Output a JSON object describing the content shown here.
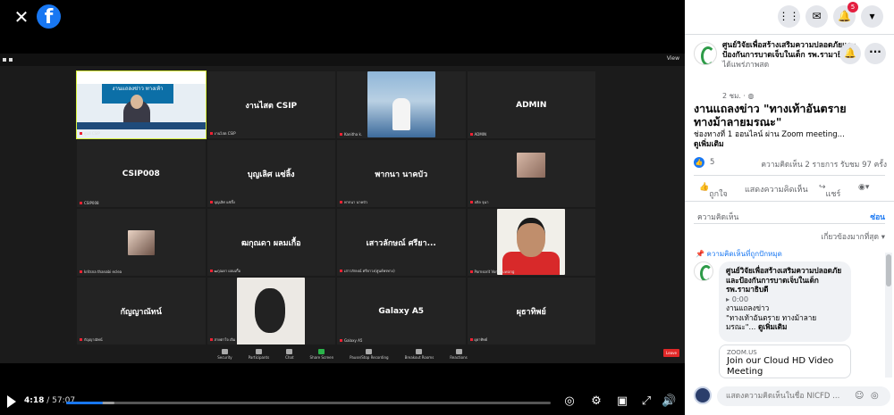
{
  "video": {
    "close_icon": "close-icon",
    "logo_letter": "f",
    "zoom": {
      "view_label": "View",
      "tiles": [
        {
          "name": "",
          "label": "ศูนย์ CSIP",
          "kind": "speaker",
          "slide_text": "งานแถลงข่าว ทางเท้า"
        },
        {
          "name": "งานไสต CSIP",
          "label": "งานไสต CSIP",
          "kind": "name"
        },
        {
          "name": "",
          "label": "Kanitha k.",
          "kind": "photo-lady"
        },
        {
          "name": "ADMIN",
          "label": "ADMIN",
          "kind": "name"
        },
        {
          "name": "CSIP008",
          "label": "CSIP008",
          "kind": "name"
        },
        {
          "name": "บุญเลิศ แซ่ลิ้ง",
          "label": "บุญเลิศ แซ่ลิ้ง",
          "kind": "name"
        },
        {
          "name": "พากนา นาคบัว",
          "label": "พากนา นาคบัว",
          "kind": "name"
        },
        {
          "name": "",
          "label": "ลลิล จุนา",
          "kind": "photo-small1"
        },
        {
          "name": "",
          "label": "kritsna thanabi eclea",
          "kind": "photo-small2"
        },
        {
          "name": "ฒกุณดา ผลมเกื้อ",
          "label": "ฒกุณดา ผลมเกื้อ",
          "kind": "name"
        },
        {
          "name": "เสาวลักษณ์ ศรียา...",
          "label": "เสาวลักษณ์ ศรียาวง(ศูนย์พรทาง)",
          "kind": "name"
        },
        {
          "name": "",
          "label": "Pornsorit Vorrasuwang",
          "kind": "photo-man"
        },
        {
          "name": "กัญญาณัทน์",
          "label": "กัญญาณัทน์",
          "kind": "name"
        },
        {
          "name": "",
          "label": "สายตาใจ เจิม",
          "kind": "photo-woman"
        },
        {
          "name": "Galaxy A5",
          "label": "Galaxy A5",
          "kind": "name"
        },
        {
          "name": "ผุธาทิพย์",
          "label": "ผุธาทิพย์",
          "kind": "name"
        }
      ],
      "controls": [
        "Security",
        "Participants",
        "Chat",
        "Share Screen",
        "Pause/Stop Recording",
        "Breakout Rooms",
        "Reactions"
      ],
      "end_label": "Leave"
    },
    "player": {
      "current_time": "4:18",
      "total_time": " / 57:07",
      "progress": 0.075,
      "buffered": 0.1
    }
  },
  "sidebar": {
    "notification_count": "5",
    "page_name": "ศูนย์วิจัยเพื่อสร้างเสริมความปลอดภัยและป้องกันการบาดเจ็บในเด็ก รพ.รามาธิบดี",
    "page_suffix": " ได้แพร่ภาพสด",
    "post_time": "2 ชม. · ",
    "globe_icon": "globe-icon",
    "post_title": "งานแถลงข่าว \"ทางเท้าอันตราย ทางม้าลายมรณะ\"",
    "post_desc": "ช่องทางที่ 1 ออนไลน์ ผ่าน Zoom meeting...",
    "see_more": "ดูเพิ่มเติม",
    "like_count": "5",
    "stats": "ความคิดเห็น 2 รายการ  รับชม 97 ครั้ง",
    "actions": {
      "like": "ถูกใจ",
      "comment": "แสดงความคิดเห็น",
      "share": "แชร์"
    },
    "comments_label": "ความคิดเห็น",
    "hide_label": "ซ่อน",
    "sort_label": "เกี่ยวข้องมากที่สุด",
    "pinned_label": "ความคิดเห็นที่ถูกปักหมุด",
    "comment": {
      "author": "ศูนย์วิจัยเพื่อสร้างเสริมความปลอดภัยและป้องกันการบาดเจ็บในเด็ก รพ.รามาธิบดี",
      "duration": "0:00",
      "text_line1": "งานแถลงข่าว",
      "text_line2": "\"ทางเท้าอันตราย ทางม้าลาย",
      "text_line3": "มรณะ\"... ",
      "see_more": "ดูเพิ่มเติม"
    },
    "link_card": {
      "source": "ZOOM.US",
      "title": "Join our Cloud HD Video Meeting"
    },
    "composer_placeholder": "แสดงความคิดเห็นในชื่อ NICFD ..."
  }
}
